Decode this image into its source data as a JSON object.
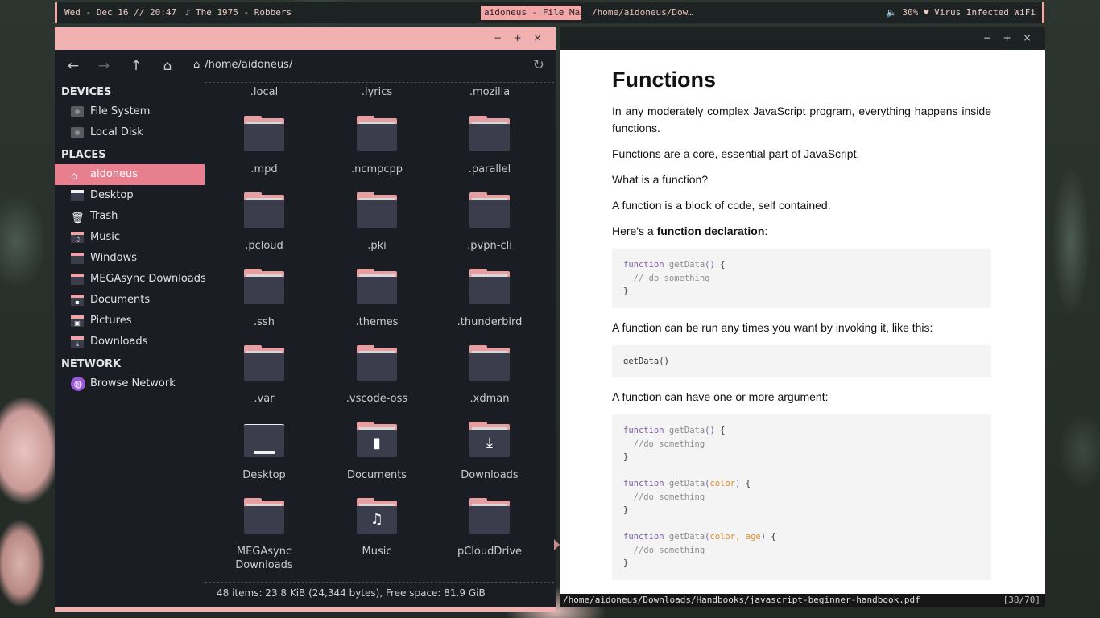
{
  "topbar": {
    "datetime": "Wed - Dec 16 // 20:47",
    "music": "♪ The 1975 - Robbers",
    "active_task": "aidoneus - File Ma…",
    "task2": "/home/aidoneus/Dow…",
    "status": "🔈 30%  ♥ Virus Infected WiFi"
  },
  "window_buttons": {
    "minimize": "−",
    "maximize": "+",
    "close": "×"
  },
  "fm": {
    "path": "/home/aidoneus/",
    "toolbar": {
      "back": "←",
      "forward": "→",
      "up": "↑",
      "home": "⌂",
      "refresh": "↻"
    },
    "sections": {
      "devices": "DEVICES",
      "places": "PLACES",
      "network": "NETWORK"
    },
    "devices": [
      "File System",
      "Local Disk"
    ],
    "places": [
      "aidoneus",
      "Desktop",
      "Trash",
      "Music",
      "Windows",
      "MEGAsync Downloads",
      "Documents",
      "Pictures",
      "Downloads"
    ],
    "network": [
      "Browse Network"
    ],
    "top_row": [
      ".local",
      ".lyrics",
      ".mozilla"
    ],
    "folders": [
      ".mpd",
      ".ncmpcpp",
      ".parallel",
      ".pcloud",
      ".pki",
      ".pvpn-cli",
      ".ssh",
      ".themes",
      ".thunderbird",
      ".var",
      ".vscode-oss",
      ".xdman",
      "Desktop",
      "Documents",
      "Downloads",
      "MEGAsync\nDownloads",
      "Music",
      "pCloudDrive"
    ],
    "status": "48 items: 23.8 KiB (24,344 bytes), Free space: 81.9 GiB"
  },
  "pdf": {
    "heading": "Functions",
    "p1": "In any moderately complex JavaScript program, everything happens inside functions.",
    "p2": "Functions are a core, essential part of JavaScript.",
    "p3": "What is a function?",
    "p4": "A function is a block of code, self contained.",
    "p5_prefix": "Here's a ",
    "p5_bold": "function declaration",
    "p5_suffix": ":",
    "p6": "A function can be run any times you want by invoking it, like this:",
    "code2": "getData()",
    "p7": "A function can have one or more argument:",
    "status_path": "/home/aidoneus/Downloads/Handbooks/javascript-beginner-handbook.pdf",
    "page": "[38/70]"
  }
}
